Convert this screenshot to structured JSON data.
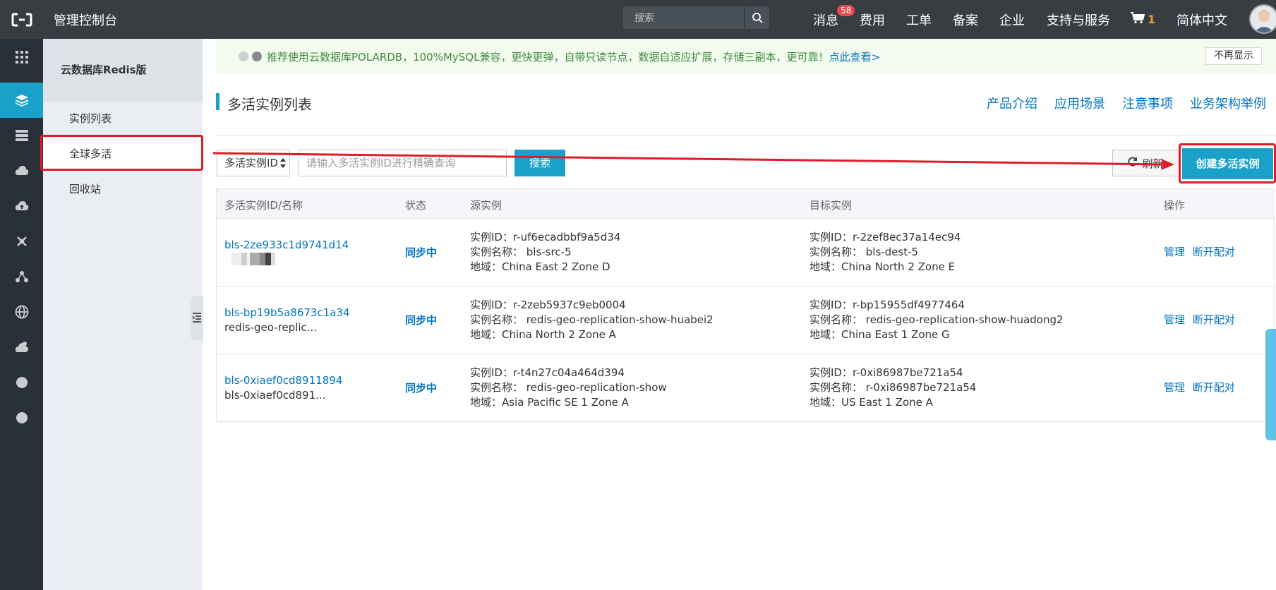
{
  "header": {
    "console_title": "管理控制台",
    "search_placeholder": "搜索",
    "nav": {
      "messages": "消息",
      "messages_count": "58",
      "fees": "费用",
      "tickets": "工单",
      "icp": "备案",
      "enterprise": "企业",
      "support": "支持与服务",
      "cart_count": "1",
      "language": "简体中文"
    }
  },
  "sidebar": {
    "title": "云数据库Redis版",
    "items": [
      {
        "label": "实例列表"
      },
      {
        "label": "全球多活"
      },
      {
        "label": "回收站"
      }
    ]
  },
  "notice": {
    "text": "推荐使用云数据库POLARDB，100%MySQL兼容，更快更弹，自带只读节点，数据自适应扩展，存储三副本，更可靠！",
    "link": "点此查看>",
    "dismiss": "不再显示"
  },
  "page": {
    "title": "多活实例列表",
    "links": [
      {
        "label": "产品介绍"
      },
      {
        "label": "应用场景"
      },
      {
        "label": "注意事项"
      },
      {
        "label": "业务架构举例"
      }
    ]
  },
  "toolbar": {
    "select_value": "多活实例ID",
    "input_placeholder": "请输入多活实例ID进行精确查询",
    "search_label": "搜索",
    "refresh_label": "刷新",
    "create_label": "创建多活实例"
  },
  "table": {
    "headers": {
      "id": "多活实例ID/名称",
      "status": "状态",
      "source": "源实例",
      "target": "目标实例",
      "ops": "操作"
    },
    "rows": [
      {
        "id": "bls-2ze933c1d9741d14",
        "name": "",
        "status": "同步中",
        "source": {
          "id": "实例ID：r-uf6ecadbbf9a5d34",
          "name": "实例名称：  bls-src-5",
          "region": "地域：China East 2 Zone D"
        },
        "target": {
          "id": "实例ID：r-2zef8ec37a14ec94",
          "name": "实例名称：  bls-dest-5",
          "region": "地域：China North 2 Zone E"
        },
        "ops": {
          "manage": "管理",
          "disconnect": "断开配对"
        }
      },
      {
        "id": "bls-bp19b5a8673c1a34",
        "name": "redis-geo-replic...",
        "status": "同步中",
        "source": {
          "id": "实例ID：r-2zeb5937c9eb0004",
          "name": "实例名称：  redis-geo-replication-show-huabei2",
          "region": "地域：China North 2 Zone A"
        },
        "target": {
          "id": "实例ID：r-bp15955df4977464",
          "name": "实例名称：  redis-geo-replication-show-huadong2",
          "region": "地域：China East 1 Zone G"
        },
        "ops": {
          "manage": "管理",
          "disconnect": "断开配对"
        }
      },
      {
        "id": "bls-0xiaef0cd8911894",
        "name": "bls-0xiaef0cd891...",
        "status": "同步中",
        "source": {
          "id": "实例ID：r-t4n27c04a464d394",
          "name": "实例名称：  redis-geo-replication-show",
          "region": "地域：Asia Pacific SE 1 Zone A"
        },
        "target": {
          "id": "实例ID：r-0xi86987be721a54",
          "name": "实例名称：  r-0xi86987be721a54",
          "region": "地域：US East 1 Zone A"
        },
        "ops": {
          "manage": "管理",
          "disconnect": "断开配对"
        }
      }
    ]
  },
  "colors": {
    "topbar": "#373d41",
    "rail": "#293038",
    "accent": "#1aa1c9",
    "link": "#0073c3",
    "annotation": "#e01a2a"
  }
}
